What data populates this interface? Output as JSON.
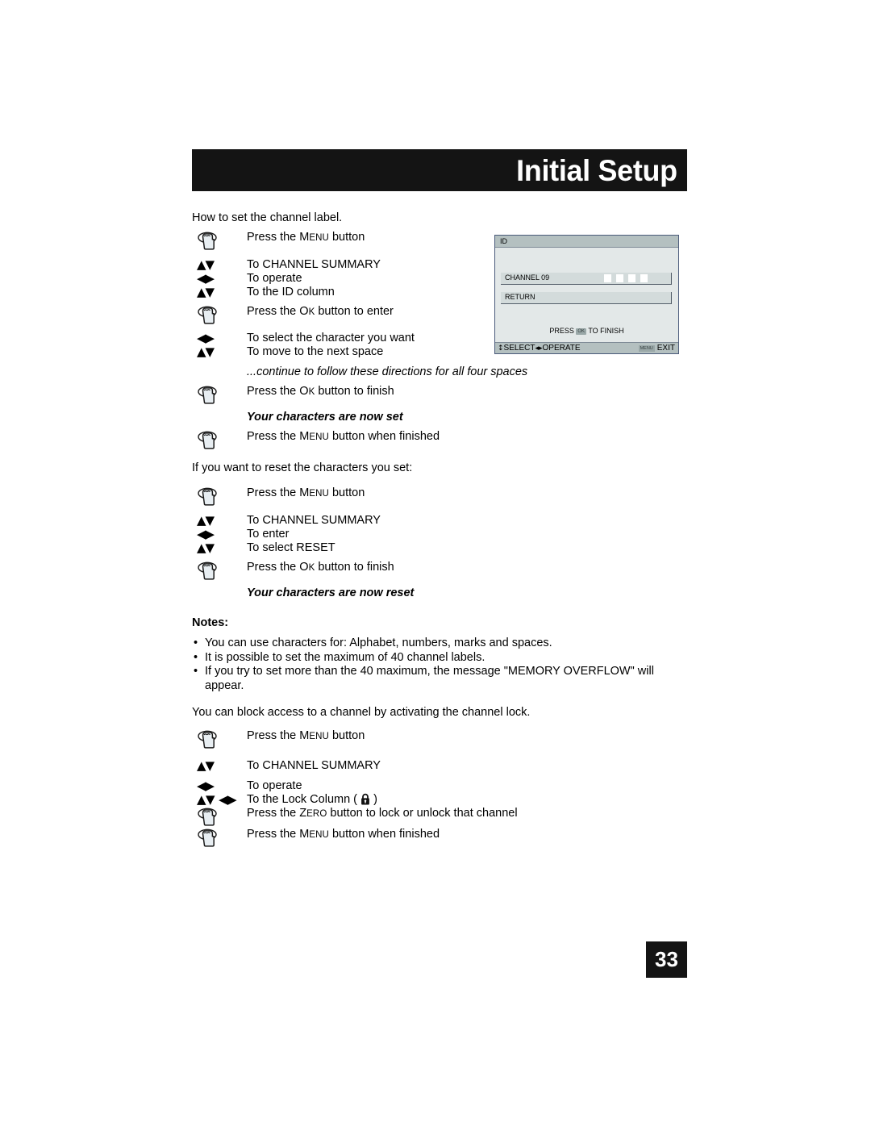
{
  "header": {
    "title": "Initial Setup"
  },
  "page_number": "33",
  "sections": {
    "intro": "How to set the channel label.",
    "reset_intro": "If you want to reset the characters you set:",
    "lock_intro": "You can block access to a channel by activating the channel lock."
  },
  "steps_label": [
    {
      "icon": "hand-press-icon",
      "pre": "Press the ",
      "kc": "M",
      "kr": "ENU",
      "post": " button"
    },
    {
      "icon": "updown-arrows-icon",
      "text": "To CHANNEL SUMMARY"
    },
    {
      "icon": "leftright-arrows-icon",
      "text": "To operate"
    },
    {
      "icon": "updown-arrows-icon",
      "text": "To the ID column"
    },
    {
      "icon": "hand-press-icon",
      "pre": "Press the ",
      "kc": "O",
      "kr": "K",
      "post": " button to enter"
    },
    {
      "icon": "leftright-arrows-icon",
      "text": "To select the character you want"
    },
    {
      "icon": "updown-arrows-icon",
      "text": "To move to the next space"
    }
  ],
  "italic_continue": "...continue to follow these directions for all four spaces",
  "steps_label_end": [
    {
      "icon": "hand-press-icon",
      "pre": "Press the ",
      "kc": "O",
      "kr": "K",
      "post": " button to finish"
    }
  ],
  "italic_set": "Your characters are now set",
  "steps_label_finish": [
    {
      "icon": "hand-press-icon",
      "pre": "Press the ",
      "kc": "M",
      "kr": "ENU",
      "post": " button when finished"
    }
  ],
  "steps_reset": [
    {
      "icon": "hand-press-icon",
      "pre": "Press the ",
      "kc": "M",
      "kr": "ENU",
      "post": " button"
    },
    {
      "icon": "updown-arrows-icon",
      "text": "To CHANNEL SUMMARY"
    },
    {
      "icon": "leftright-arrows-icon",
      "text": "To enter"
    },
    {
      "icon": "updown-arrows-icon",
      "text": "To select RESET"
    },
    {
      "icon": "hand-press-icon",
      "pre": "Press the ",
      "kc": "O",
      "kr": "K",
      "post": " button to finish"
    }
  ],
  "italic_reset": "Your characters are now reset",
  "notes": {
    "heading": "Notes:",
    "bullet_char": "•",
    "items": [
      "You can use characters for: Alphabet, numbers, marks and spaces.",
      "It is possible to set the maximum of 40 channel labels.",
      "If you try to set more than the 40 maximum, the message \"MEMORY OVERFLOW\" will appear."
    ]
  },
  "steps_lock": [
    {
      "icon": "hand-press-icon",
      "pre": "Press the ",
      "kc": "M",
      "kr": "ENU",
      "post": " button"
    },
    {
      "icon": "updown-arrows-icon",
      "text": "To CHANNEL SUMMARY"
    },
    {
      "icon": "leftright-arrows-icon",
      "text": "To operate"
    },
    {
      "icon": "updown-leftright-arrows-icon",
      "pre": "To the Lock Column ( ",
      "post": " )"
    },
    {
      "icon": "hand-press-icon",
      "pre": "Press the ",
      "kc": "Z",
      "kr": "ERO",
      "post": " button to lock or unlock that channel"
    },
    {
      "icon": "hand-press-icon",
      "pre": "Press the ",
      "kc": "M",
      "kr": "ENU",
      "post": " button when finished"
    }
  ],
  "osd": {
    "title": "ID",
    "row1_label": "CHANNEL 09",
    "row1_char_boxes": 4,
    "row2_label": "RETURN",
    "finish_pre": "PRESS ",
    "finish_badge": "OK",
    "finish_post": " TO FINISH",
    "foot_select": "SELECT",
    "foot_operate": "OPERATE",
    "foot_menu_badge": "MENU",
    "foot_exit": "EXIT",
    "foot_updown_glyph": "↕",
    "foot_leftright_glyph": "◂▸"
  },
  "glyphs": {
    "up": "▲",
    "down": "▼",
    "left": "◀",
    "right": "▶"
  },
  "colors": {
    "header_bg": "#141414",
    "header_text": "#ffffff",
    "osd_border": "#4a5a7a",
    "osd_title_bg": "#b4c0c0",
    "osd_body_bg": "#e3e8e8",
    "osd_row_bg": "#d3dbdb",
    "page_badge_bg": "#141414"
  }
}
